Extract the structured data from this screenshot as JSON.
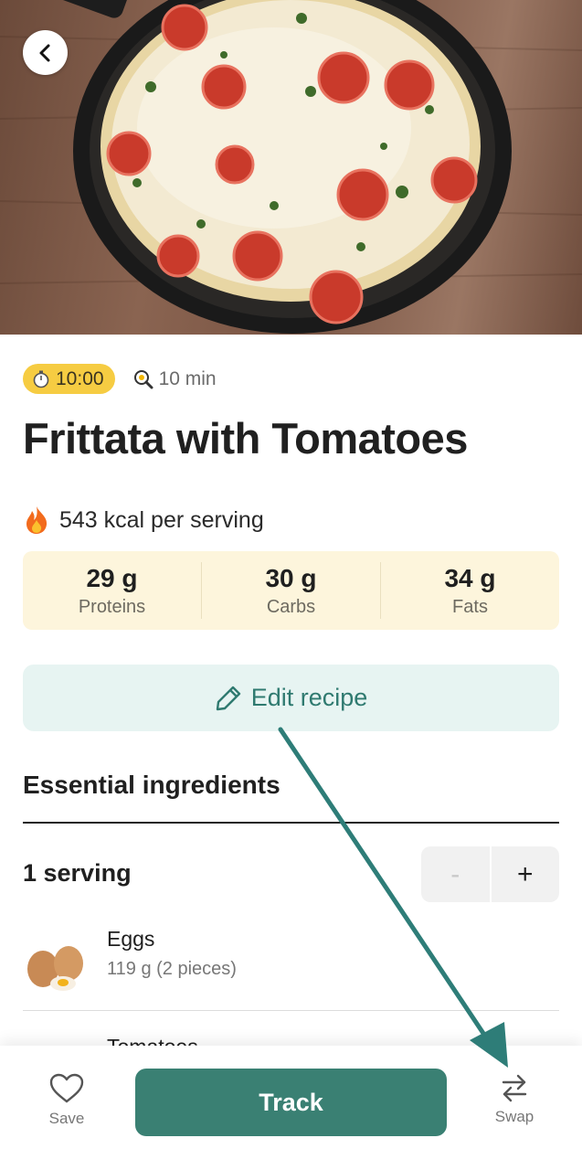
{
  "hero": {
    "image_icon": "frittata-pan-photo",
    "back_icon": "chevron-left-icon"
  },
  "meta": {
    "timer_badge": "10:00",
    "timer_icon": "stopwatch-icon",
    "cook_time": "10 min",
    "cook_icon": "frying-pan-icon",
    "badge_color": "#f6cc42"
  },
  "recipe": {
    "title": "Frittata with Tomatoes"
  },
  "nutrition": {
    "kcal_icon": "fire-icon",
    "kcal_text": "543 kcal per serving",
    "macros": [
      {
        "value": "29 g",
        "label": "Proteins"
      },
      {
        "value": "30 g",
        "label": "Carbs"
      },
      {
        "value": "34 g",
        "label": "Fats"
      }
    ]
  },
  "edit": {
    "label": "Edit recipe",
    "icon": "pencil-icon"
  },
  "ingredients": {
    "section_title": "Essential ingredients",
    "serving_label": "1 serving",
    "minus_label": "-",
    "plus_label": "+",
    "items": [
      {
        "name": "Eggs",
        "qty": "119 g (2 pieces)",
        "icon": "eggs-icon"
      },
      {
        "name": "Tomatoes",
        "qty": "",
        "icon": "tomatoes-icon"
      }
    ]
  },
  "bottom_bar": {
    "save_label": "Save",
    "save_icon": "heart-outline-icon",
    "track_label": "Track",
    "swap_label": "Swap",
    "swap_icon": "swap-arrows-icon",
    "accent": "#3a8073"
  },
  "annotation": {
    "arrow_color": "#2e7d78",
    "arrow_icon": "annotation-arrow"
  }
}
